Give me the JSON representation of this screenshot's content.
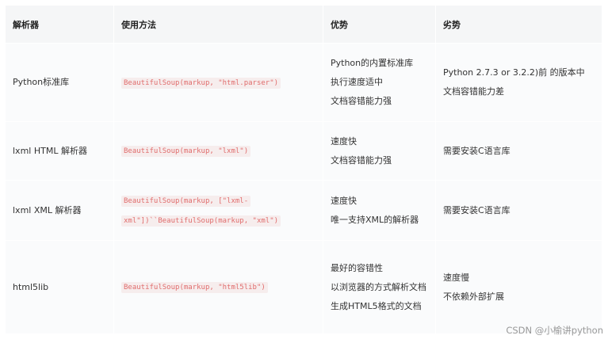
{
  "table": {
    "headers": [
      "解析器",
      "使用方法",
      "优势",
      "劣势"
    ],
    "rows": [
      {
        "parser": "Python标准库",
        "usage": "BeautifulSoup(markup, \"html.parser\")",
        "advantages": [
          "Python的内置标准库",
          "执行速度适中",
          "文档容错能力强"
        ],
        "disadvantages": [
          "Python 2.7.3 or 3.2.2)前 的版本中",
          "文档容错能力差"
        ]
      },
      {
        "parser": "lxml HTML 解析器",
        "usage": "BeautifulSoup(markup, \"lxml\")",
        "advantages": [
          "速度快",
          "文档容错能力强"
        ],
        "disadvantages": [
          "需要安装C语言库"
        ]
      },
      {
        "parser": "lxml XML 解析器",
        "usage": "BeautifulSoup(markup, [\"lxml-xml\"])``BeautifulSoup(markup, \"xml\")",
        "advantages": [
          "速度快",
          "唯一支持XML的解析器"
        ],
        "disadvantages": [
          "需要安装C语言库"
        ]
      },
      {
        "parser": "html5lib",
        "usage": "BeautifulSoup(markup, \"html5lib\")",
        "advantages": [
          "最好的容错性",
          "以浏览器的方式解析文档",
          "生成HTML5格式的文档"
        ],
        "disadvantages": [
          "速度慢",
          "不依赖外部扩展"
        ]
      }
    ]
  },
  "watermark": "CSDN @小榆讲python"
}
